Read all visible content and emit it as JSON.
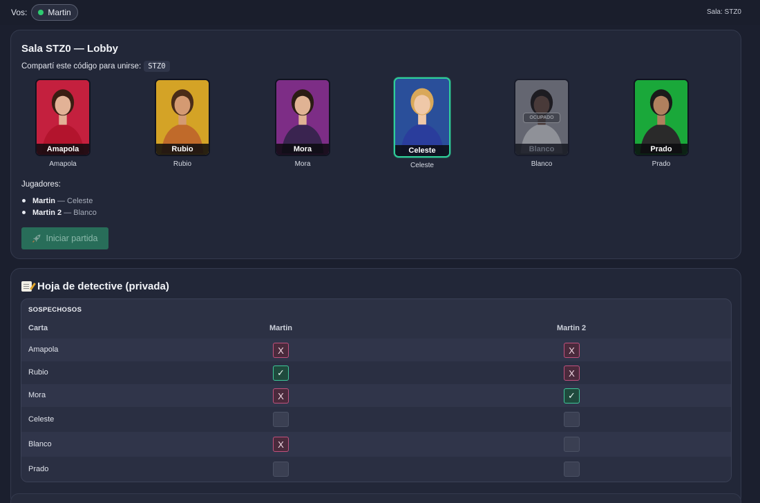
{
  "topbar": {
    "vos_label": "Vos:",
    "current_user": "Martin",
    "online_color": "#2ecc71",
    "room_label": "Sala: STZ0"
  },
  "lobby": {
    "title": "Sala STZ0 — Lobby",
    "share_text": "Compartí este código para unirse:",
    "code": "STZ0",
    "characters": [
      {
        "card_name": "Amapola",
        "caption": "Amapola",
        "bg": "#c4203e",
        "skin": "#e2b296",
        "hair": "#3a1d12",
        "outfit": "#b3142d",
        "taken": false,
        "selected": false
      },
      {
        "card_name": "Rubio",
        "caption": "Rubio",
        "bg": "#d4a326",
        "skin": "#d49a72",
        "hair": "#4a2c18",
        "outfit": "#c06a2a",
        "taken": false,
        "selected": false
      },
      {
        "card_name": "Mora",
        "caption": "Mora",
        "bg": "#7d2d86",
        "skin": "#e0b394",
        "hair": "#2a1c14",
        "outfit": "#3a2450",
        "taken": false,
        "selected": false
      },
      {
        "card_name": "Celeste",
        "caption": "Celeste",
        "bg": "#2a4f9a",
        "skin": "#efc8a8",
        "hair": "#d9a85a",
        "outfit": "#2a3d9c",
        "taken": false,
        "selected": true
      },
      {
        "card_name": "Blanco",
        "caption": "Blanco",
        "bg": "#9a9aa0",
        "skin": "#6a4a3a",
        "hair": "#1a1410",
        "outfit": "#e8e8e8",
        "taken": true,
        "selected": false,
        "badge": "OCUPADO"
      },
      {
        "card_name": "Prado",
        "caption": "Prado",
        "bg": "#1aa83a",
        "skin": "#b0805e",
        "hair": "#1a1a1a",
        "outfit": "#2a2a2a",
        "taken": false,
        "selected": false
      }
    ],
    "players_title": "Jugadores:",
    "players": [
      {
        "name": "Martin",
        "character": "— Celeste"
      },
      {
        "name": "Martin 2",
        "character": "— Blanco"
      }
    ],
    "start_button": "Iniciar partida"
  },
  "sheet": {
    "title": "Hoja de detective (privada)",
    "section": "SOSPECHOSOS",
    "columns": [
      "Carta",
      "Martin",
      "Martin 2"
    ],
    "rows": [
      {
        "label": "Amapola",
        "marks": [
          "x",
          "x"
        ]
      },
      {
        "label": "Rubio",
        "marks": [
          "check",
          "x"
        ]
      },
      {
        "label": "Mora",
        "marks": [
          "x",
          "check"
        ]
      },
      {
        "label": "Celeste",
        "marks": [
          "empty",
          "empty"
        ]
      },
      {
        "label": "Blanco",
        "marks": [
          "x",
          "empty"
        ]
      },
      {
        "label": "Prado",
        "marks": [
          "empty",
          "empty"
        ]
      }
    ],
    "mark_symbols": {
      "x": "X",
      "check": "✓",
      "empty": ""
    }
  }
}
